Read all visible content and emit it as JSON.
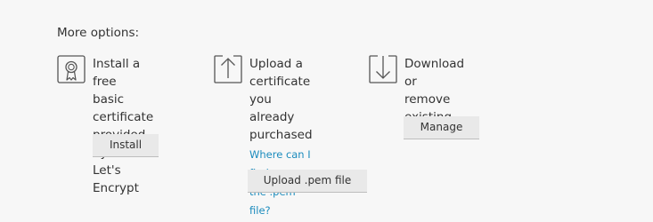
{
  "section_title": "More options:",
  "options": [
    {
      "icon": "certificate-ribbon-icon",
      "description": "Install a free\nbasic certificate\nprovided by\nLet's Encrypt",
      "button_label": "Install"
    },
    {
      "icon": "upload-arrow-icon",
      "description": "Upload a\ncertificate you\nalready\npurchased",
      "help_link": "Where can I find\nthe .pem file?",
      "button_label": "Upload .pem file"
    },
    {
      "icon": "download-arrow-icon",
      "description": "Download or\nremove existing\ncertificates",
      "button_label": "Manage"
    }
  ],
  "colors": {
    "background": "#f7f7f7",
    "text": "#333333",
    "link": "#1a8bbd",
    "button_bg": "#e9e9e9",
    "icon_stroke": "#555555"
  }
}
